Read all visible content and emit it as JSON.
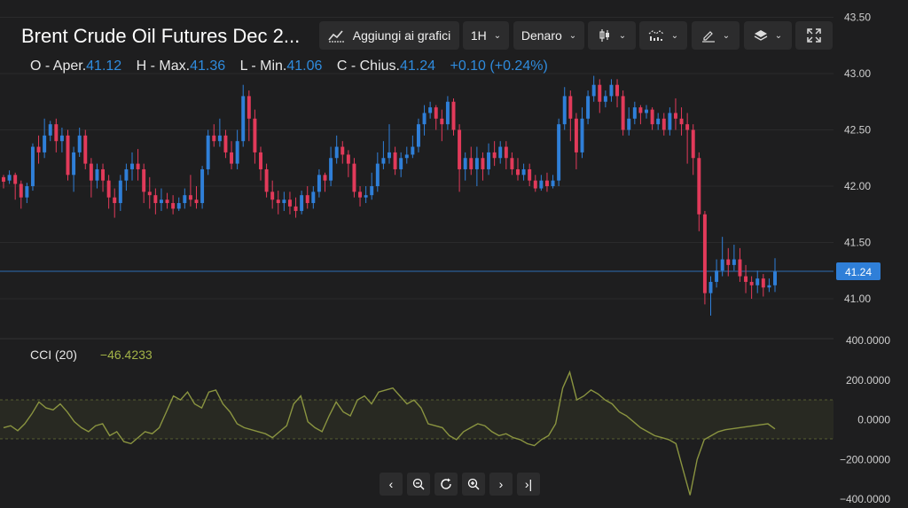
{
  "header": {
    "title": "Brent Crude Oil Futures Dec 2...",
    "ohlc": [
      {
        "label": "O - Aper.",
        "value": "41.12"
      },
      {
        "label": "H - Max.",
        "value": "41.36"
      },
      {
        "label": "L - Min.",
        "value": "41.06"
      },
      {
        "label": "C - Chius.",
        "value": "41.24"
      }
    ],
    "change": "+0.10 (+0.24%)"
  },
  "toolbar": {
    "add_to_charts_label": "Aggiungi ai grafici",
    "interval_label": "1H",
    "price_type_label": "Denaro",
    "chart_type_icon": "candlestick-icon",
    "indicators_icon": "indicators-icon",
    "drawing_icon": "pencil-icon",
    "layers_icon": "layers-icon",
    "fullscreen_icon": "fullscreen-icon"
  },
  "indicator": {
    "name": "CCI (20)",
    "value": "−46.4233"
  },
  "price_axis": {
    "ticks": [
      "43.50",
      "43.00",
      "42.50",
      "42.00",
      "41.50",
      "41.00"
    ],
    "current_price": "41.24"
  },
  "cci_axis": {
    "ticks": [
      "400.0000",
      "200.0000",
      "0.0000",
      "−200.0000",
      "−400.0000"
    ]
  },
  "nav_buttons": [
    "scroll-left",
    "zoom-out",
    "reset",
    "zoom-in",
    "scroll-right",
    "scroll-to-end"
  ],
  "colors": {
    "background": "#1e1e1f",
    "up": "#2f7fd8",
    "down": "#e23a5a",
    "cci_line": "#8a9440",
    "accent": "#2f8bdd"
  },
  "chart_data": {
    "type": "candlestick",
    "price_range": [
      40.75,
      43.5
    ],
    "candles": [
      [
        42.08,
        42.04,
        42.1,
        41.98
      ],
      [
        42.05,
        42.1,
        42.14,
        42.02
      ],
      [
        42.1,
        42.02,
        42.12,
        41.88
      ],
      [
        42.02,
        41.9,
        42.05,
        41.8
      ],
      [
        41.9,
        42.0,
        42.03,
        41.85
      ],
      [
        42.0,
        42.35,
        42.38,
        41.96
      ],
      [
        42.35,
        42.3,
        42.45,
        42.2
      ],
      [
        42.3,
        42.45,
        42.6,
        42.25
      ],
      [
        42.45,
        42.55,
        42.58,
        42.4
      ],
      [
        42.55,
        42.4,
        42.6,
        42.3
      ],
      [
        42.4,
        42.45,
        42.52,
        42.3
      ],
      [
        42.45,
        42.1,
        42.5,
        42.05
      ],
      [
        42.1,
        42.3,
        42.35,
        41.95
      ],
      [
        42.3,
        42.45,
        42.52,
        42.26
      ],
      [
        42.45,
        42.2,
        42.5,
        42.15
      ],
      [
        42.2,
        42.05,
        42.25,
        41.9
      ],
      [
        42.05,
        42.15,
        42.2,
        41.98
      ],
      [
        42.15,
        42.05,
        42.2,
        41.95
      ],
      [
        42.05,
        41.9,
        42.1,
        41.8
      ],
      [
        41.9,
        41.85,
        41.98,
        41.72
      ],
      [
        41.85,
        42.05,
        42.1,
        41.78
      ],
      [
        42.05,
        42.15,
        42.2,
        41.96
      ],
      [
        42.15,
        42.2,
        42.3,
        42.05
      ],
      [
        42.2,
        42.15,
        42.33,
        42.05
      ],
      [
        42.15,
        41.95,
        42.2,
        41.85
      ],
      [
        41.95,
        41.92,
        42.08,
        41.8
      ],
      [
        41.92,
        41.85,
        41.98,
        41.75
      ],
      [
        41.85,
        41.88,
        41.98,
        41.78
      ],
      [
        41.88,
        41.85,
        41.94,
        41.8
      ],
      [
        41.85,
        41.8,
        41.92,
        41.75
      ],
      [
        41.8,
        41.85,
        41.9,
        41.78
      ],
      [
        41.85,
        41.92,
        41.98,
        41.8
      ],
      [
        41.92,
        41.88,
        42.1,
        41.82
      ],
      [
        41.88,
        41.85,
        42.0,
        41.8
      ],
      [
        41.85,
        42.15,
        42.18,
        41.8
      ],
      [
        42.15,
        42.45,
        42.5,
        42.1
      ],
      [
        42.45,
        42.4,
        42.55,
        42.35
      ],
      [
        42.4,
        42.45,
        42.6,
        42.35
      ],
      [
        42.45,
        42.3,
        42.5,
        42.25
      ],
      [
        42.3,
        42.2,
        42.4,
        42.15
      ],
      [
        42.2,
        42.4,
        42.5,
        42.15
      ],
      [
        42.4,
        42.8,
        42.9,
        42.35
      ],
      [
        42.8,
        42.6,
        42.85,
        42.4
      ],
      [
        42.6,
        42.3,
        42.68,
        42.2
      ],
      [
        42.3,
        42.15,
        42.35,
        42.05
      ],
      [
        42.15,
        41.95,
        42.2,
        41.9
      ],
      [
        41.95,
        41.88,
        42.05,
        41.8
      ],
      [
        41.88,
        41.85,
        41.96,
        41.75
      ],
      [
        41.85,
        41.88,
        41.95,
        41.78
      ],
      [
        41.88,
        41.82,
        41.95,
        41.75
      ],
      [
        41.82,
        41.78,
        41.9,
        41.72
      ],
      [
        41.78,
        41.92,
        41.96,
        41.75
      ],
      [
        41.92,
        41.85,
        42.0,
        41.8
      ],
      [
        41.85,
        41.95,
        42.0,
        41.8
      ],
      [
        41.95,
        42.1,
        42.15,
        41.9
      ],
      [
        42.1,
        42.05,
        42.12,
        41.95
      ],
      [
        42.05,
        42.25,
        42.35,
        42.0
      ],
      [
        42.25,
        42.35,
        42.45,
        42.2
      ],
      [
        42.35,
        42.28,
        42.4,
        42.2
      ],
      [
        42.28,
        42.2,
        42.32,
        42.08
      ],
      [
        42.2,
        41.95,
        42.25,
        41.9
      ],
      [
        41.95,
        41.9,
        42.0,
        41.82
      ],
      [
        41.9,
        41.92,
        42.0,
        41.85
      ],
      [
        41.92,
        42.0,
        42.12,
        41.88
      ],
      [
        42.0,
        42.2,
        42.3,
        41.95
      ],
      [
        42.2,
        42.25,
        42.4,
        42.15
      ],
      [
        42.25,
        42.3,
        42.55,
        42.2
      ],
      [
        42.3,
        42.15,
        42.35,
        42.1
      ],
      [
        42.15,
        42.25,
        42.3,
        42.08
      ],
      [
        42.25,
        42.28,
        42.35,
        42.2
      ],
      [
        42.28,
        42.35,
        42.45,
        42.25
      ],
      [
        42.35,
        42.55,
        42.6,
        42.3
      ],
      [
        42.55,
        42.65,
        42.72,
        42.45
      ],
      [
        42.65,
        42.7,
        42.75,
        42.6
      ],
      [
        42.7,
        42.6,
        42.72,
        42.5
      ],
      [
        42.6,
        42.55,
        42.68,
        42.4
      ],
      [
        42.55,
        42.75,
        42.8,
        42.5
      ],
      [
        42.75,
        42.5,
        42.78,
        42.45
      ],
      [
        42.5,
        42.15,
        42.55,
        41.95
      ],
      [
        42.15,
        42.25,
        42.3,
        42.05
      ],
      [
        42.25,
        42.15,
        42.35,
        42.1
      ],
      [
        42.15,
        42.25,
        42.35,
        42.0
      ],
      [
        42.25,
        42.15,
        42.3,
        42.05
      ],
      [
        42.15,
        42.3,
        42.38,
        42.1
      ],
      [
        42.3,
        42.25,
        42.4,
        42.18
      ],
      [
        42.25,
        42.35,
        42.4,
        42.2
      ],
      [
        42.35,
        42.25,
        42.4,
        42.15
      ],
      [
        42.25,
        42.15,
        42.3,
        42.1
      ],
      [
        42.15,
        42.1,
        42.25,
        42.05
      ],
      [
        42.1,
        42.15,
        42.2,
        42.05
      ],
      [
        42.15,
        42.05,
        42.2,
        42.0
      ],
      [
        42.05,
        41.98,
        42.1,
        41.95
      ],
      [
        41.98,
        42.05,
        42.1,
        41.96
      ],
      [
        42.05,
        42.0,
        42.12,
        41.95
      ],
      [
        42.0,
        42.05,
        42.1,
        41.98
      ],
      [
        42.05,
        42.55,
        42.6,
        42.0
      ],
      [
        42.55,
        42.8,
        42.88,
        42.5
      ],
      [
        42.8,
        42.6,
        42.85,
        42.4
      ],
      [
        42.6,
        42.3,
        42.65,
        42.15
      ],
      [
        42.3,
        42.6,
        42.7,
        42.25
      ],
      [
        42.6,
        42.8,
        42.85,
        42.55
      ],
      [
        42.8,
        42.9,
        42.98,
        42.75
      ],
      [
        42.9,
        42.75,
        42.95,
        42.65
      ],
      [
        42.75,
        42.8,
        42.85,
        42.7
      ],
      [
        42.8,
        42.9,
        42.95,
        42.75
      ],
      [
        42.9,
        42.8,
        42.95,
        42.7
      ],
      [
        42.8,
        42.5,
        42.85,
        42.45
      ],
      [
        42.5,
        42.6,
        42.7,
        42.45
      ],
      [
        42.6,
        42.7,
        42.75,
        42.55
      ],
      [
        42.7,
        42.65,
        42.72,
        42.55
      ],
      [
        42.65,
        42.68,
        42.72,
        42.6
      ],
      [
        42.68,
        42.55,
        42.7,
        42.5
      ],
      [
        42.55,
        42.6,
        42.65,
        42.5
      ],
      [
        42.6,
        42.5,
        42.65,
        42.45
      ],
      [
        42.5,
        42.65,
        42.7,
        42.45
      ],
      [
        42.65,
        42.6,
        42.78,
        42.5
      ],
      [
        42.6,
        42.55,
        42.7,
        42.45
      ],
      [
        42.55,
        42.5,
        42.65,
        42.2
      ],
      [
        42.5,
        42.25,
        42.55,
        42.1
      ],
      [
        42.25,
        41.75,
        42.3,
        41.6
      ],
      [
        41.75,
        41.05,
        41.78,
        40.95
      ],
      [
        41.05,
        41.15,
        41.2,
        40.85
      ],
      [
        41.15,
        41.25,
        41.35,
        41.1
      ],
      [
        41.25,
        41.35,
        41.55,
        41.2
      ],
      [
        41.35,
        41.3,
        41.45,
        41.2
      ],
      [
        41.3,
        41.35,
        41.48,
        41.25
      ],
      [
        41.35,
        41.2,
        41.45,
        41.15
      ],
      [
        41.2,
        41.15,
        41.3,
        41.05
      ],
      [
        41.15,
        41.12,
        41.2,
        41.0
      ],
      [
        41.12,
        41.18,
        41.25,
        41.05
      ],
      [
        41.18,
        41.1,
        41.22,
        41.02
      ],
      [
        41.1,
        41.12,
        41.18,
        41.06
      ],
      [
        41.12,
        41.24,
        41.36,
        41.06
      ]
    ],
    "cci_range": [
      -400,
      400
    ],
    "cci": [
      -40,
      -30,
      -55,
      -20,
      30,
      90,
      60,
      50,
      80,
      40,
      -10,
      -40,
      -60,
      -30,
      -20,
      -80,
      -60,
      -110,
      -120,
      -90,
      -60,
      -70,
      -40,
      40,
      120,
      100,
      140,
      80,
      60,
      140,
      150,
      80,
      40,
      -20,
      -40,
      -50,
      -60,
      -70,
      -90,
      -60,
      -30,
      80,
      120,
      -10,
      -40,
      -60,
      20,
      90,
      40,
      20,
      100,
      120,
      80,
      140,
      150,
      160,
      120,
      80,
      100,
      60,
      -20,
      -30,
      -40,
      -80,
      -100,
      -60,
      -40,
      -20,
      -30,
      -60,
      -80,
      -70,
      -90,
      -100,
      -120,
      -130,
      -100,
      -80,
      -20,
      160,
      240,
      100,
      120,
      150,
      130,
      100,
      80,
      40,
      20,
      -10,
      -40,
      -60,
      -80,
      -90,
      -100,
      -120,
      -250,
      -380,
      -200,
      -100,
      -80,
      -60,
      -50,
      -45,
      -40,
      -35,
      -30,
      -25,
      -20,
      -46
    ]
  }
}
